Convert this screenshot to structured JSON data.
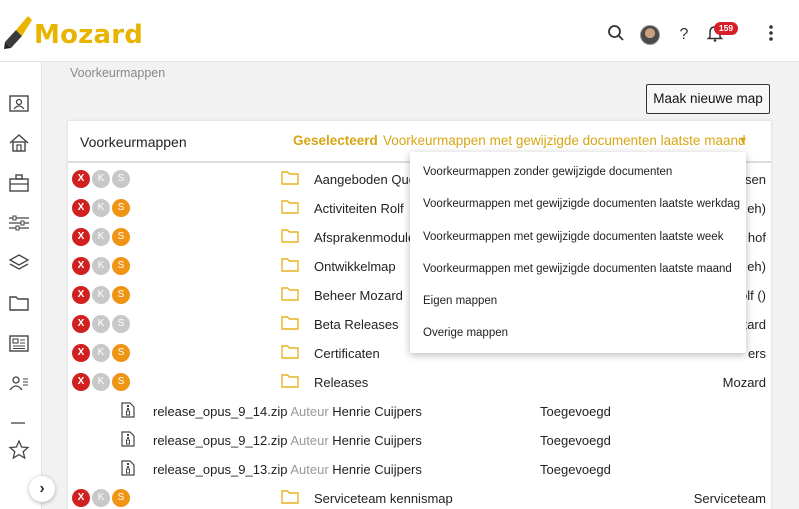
{
  "app": {
    "logo_text": "Mozard"
  },
  "topbar": {
    "notification_count": "159"
  },
  "breadcrumb": "Voorkeurmappen",
  "new_folder_button": "Maak nieuwe map",
  "panel": {
    "title": "Voorkeurmappen",
    "selected_label": "Geselecteerd",
    "selected_value": "Voorkeurmappen met gewijzigde documenten laatste maand"
  },
  "dropdown_options": [
    "Voorkeurmappen zonder gewijzigde documenten",
    "Voorkeurmappen met gewijzigde documenten laatste werkdag",
    "Voorkeurmappen met gewijzigde documenten laatste week",
    "Voorkeurmappen met gewijzigde documenten laatste maand",
    "Eigen mappen",
    "Overige mappen"
  ],
  "folders": [
    {
      "name": "Aangeboden Que",
      "owner": "sen",
      "s_active": false
    },
    {
      "name": "Activiteiten Rolf",
      "owner": "eh)",
      "s_active": true
    },
    {
      "name": "Afsprakenmodule",
      "owner": "hof",
      "s_active": true
    },
    {
      "name": "Ontwikkelmap",
      "owner": "eh)",
      "s_active": true
    },
    {
      "name": "Beheer Mozard",
      "owner": "olf ()",
      "s_active": true
    },
    {
      "name": "Beta Releases",
      "owner": "zard",
      "s_active": false
    },
    {
      "name": "Certificaten",
      "owner": "ers",
      "s_active": true
    },
    {
      "name": "Releases",
      "owner": "Mozard",
      "s_active": true
    }
  ],
  "files": [
    {
      "name": "release_opus_9_14.zip",
      "author_label": "Auteur",
      "author": "Henrie Cuijpers",
      "added": "Toegevoegd"
    },
    {
      "name": "release_opus_9_12.zip",
      "author_label": "Auteur",
      "author": "Henrie Cuijpers",
      "added": "Toegevoegd"
    },
    {
      "name": "release_opus_9_13.zip",
      "author_label": "Auteur",
      "author": "Henrie Cuijpers",
      "added": "Toegevoegd"
    }
  ],
  "last_folder": {
    "name": "Serviceteam kennismap",
    "owner": "Serviceteam",
    "s_active": true
  },
  "dots": {
    "x": "X",
    "k": "K",
    "s": "S"
  },
  "colors": {
    "brand": "#e8b400",
    "accent": "#d7a614",
    "x_red": "#d02020",
    "s_orange": "#ef9413",
    "badge_red": "#d61f26"
  },
  "icons": [
    "search-icon",
    "avatar",
    "help-icon",
    "bell-icon",
    "more-vertical-icon",
    "contact-card-icon",
    "home-icon",
    "briefcase-icon",
    "sliders-icon",
    "layers-icon",
    "folder-icon",
    "newspaper-icon",
    "users-icon",
    "divider",
    "star-icon",
    "chevron-right-icon",
    "zip-file-icon"
  ]
}
